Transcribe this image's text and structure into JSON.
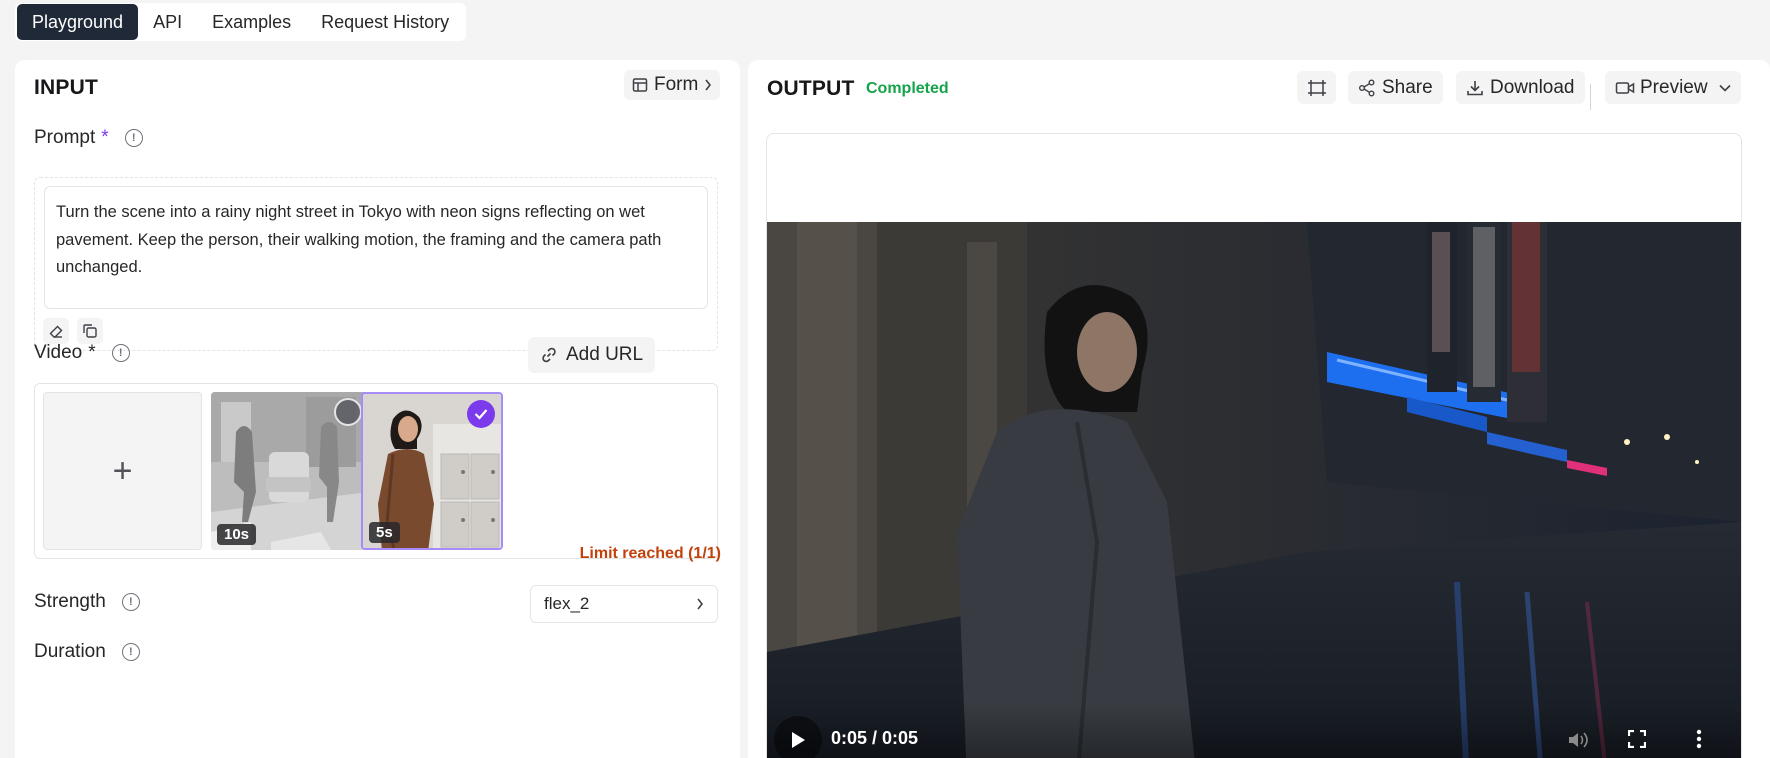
{
  "tabs": [
    {
      "label": "Playground"
    },
    {
      "label": "API"
    },
    {
      "label": "Examples"
    },
    {
      "label": "Request History"
    }
  ],
  "input": {
    "title": "INPUT",
    "form_label": "Form",
    "prompt": {
      "label": "Prompt",
      "required": "*",
      "text": "Turn the scene into a rainy night street in Tokyo with neon signs reflecting on wet pavement. Keep the person, their walking motion, the framing and the camera path unchanged."
    },
    "video": {
      "label": "Video",
      "required": "*",
      "add_url_label": "Add URL",
      "upload_symbol": "+",
      "thumbnails": [
        {
          "duration": "10s",
          "selected": false
        },
        {
          "duration": "5s",
          "selected": true
        }
      ],
      "limit_text": "Limit reached (1/1)"
    },
    "strength": {
      "label": "Strength",
      "value": "flex_2"
    },
    "duration": {
      "label": "Duration"
    }
  },
  "output": {
    "title": "OUTPUT",
    "status": "Completed",
    "share_label": "Share",
    "download_label": "Download",
    "preview_label": "Preview",
    "player": {
      "time": "0:05 / 0:05",
      "progress": 1.0
    }
  },
  "colors": {
    "accent": "#7c3aed",
    "success": "#16a34a",
    "warning": "#c2410c",
    "tab_active": "#1f2937"
  }
}
